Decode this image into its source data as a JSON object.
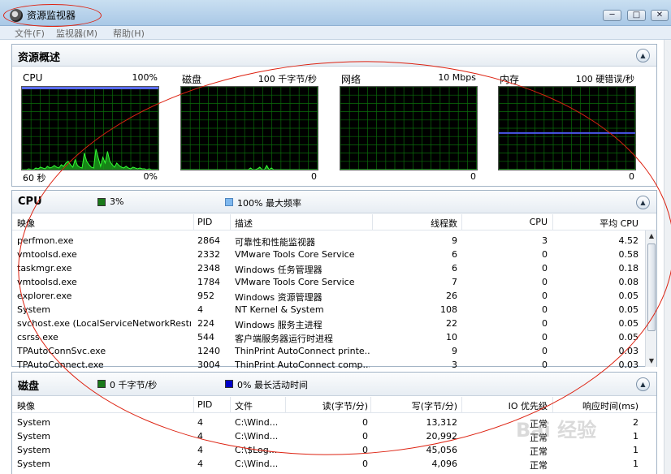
{
  "window": {
    "title": "资源监视器",
    "btn_min": "─",
    "btn_max": "□",
    "btn_close": "✕"
  },
  "menu": [
    "文件(F)",
    "监视器(M)",
    "帮助(H)"
  ],
  "overview": {
    "title": "资源概述",
    "collapse_glyph": "▲",
    "graphs": [
      {
        "label": "CPU",
        "max": "100%",
        "bottom_left": "60 秒",
        "bottom_right": "0%"
      },
      {
        "label": "磁盘",
        "max": "100 千字节/秒",
        "bottom_left": "",
        "bottom_right": "0"
      },
      {
        "label": "网络",
        "max": "10 Mbps",
        "bottom_left": "",
        "bottom_right": "0"
      },
      {
        "label": "内存",
        "max": "100 硬错误/秒",
        "bottom_left": "",
        "bottom_right": "0"
      }
    ]
  },
  "cpu": {
    "title": "CPU",
    "collapse_glyph": "▲",
    "legend1": "3%",
    "legend2": "100% 最大频率",
    "legend1_color": "#1a7a1a",
    "legend2_color": "#7fb8ee",
    "columns": [
      "映像",
      "PID",
      "描述",
      "线程数",
      "CPU",
      "平均 CPU"
    ],
    "rows": [
      [
        "perfmon.exe",
        "2864",
        "可靠性和性能监视器",
        "9",
        "3",
        "4.52"
      ],
      [
        "vmtoolsd.exe",
        "2332",
        "VMware Tools Core Service",
        "6",
        "0",
        "0.58"
      ],
      [
        "taskmgr.exe",
        "2348",
        "Windows 任务管理器",
        "6",
        "0",
        "0.18"
      ],
      [
        "vmtoolsd.exe",
        "1784",
        "VMware Tools Core Service",
        "7",
        "0",
        "0.08"
      ],
      [
        "explorer.exe",
        "952",
        "Windows 资源管理器",
        "26",
        "0",
        "0.05"
      ],
      [
        "System",
        "4",
        "NT Kernel & System",
        "108",
        "0",
        "0.05"
      ],
      [
        "svchost.exe (LocalServiceNetworkRestric...",
        "224",
        "Windows 服务主进程",
        "22",
        "0",
        "0.05"
      ],
      [
        "csrss.exe",
        "544",
        "客户端服务器运行时进程",
        "10",
        "0",
        "0.05"
      ],
      [
        "TPAutoConnSvc.exe",
        "1240",
        "ThinPrint AutoConnect printe...",
        "9",
        "0",
        "0.03"
      ],
      [
        "TPAutoConnect.exe",
        "3004",
        "ThinPrint AutoConnect comp...",
        "3",
        "0",
        "0.03"
      ]
    ]
  },
  "disk": {
    "title": "磁盘",
    "collapse_glyph": "▲",
    "legend1": "0 千字节/秒",
    "legend2": "0% 最长活动时间",
    "legend1_color": "#1a7a1a",
    "legend2_color": "#0000c8",
    "columns": [
      "映像",
      "PID",
      "文件",
      "读(字节/分)",
      "写(字节/分)",
      "IO 优先级",
      "响应时间(ms)"
    ],
    "rows": [
      [
        "System",
        "4",
        "C:\\Wind...",
        "0",
        "13,312",
        "正常",
        "2"
      ],
      [
        "System",
        "4",
        "C:\\Wind...",
        "0",
        "20,992",
        "正常",
        "1"
      ],
      [
        "System",
        "4",
        "C:\\$Log...",
        "0",
        "45,056",
        "正常",
        "1"
      ],
      [
        "System",
        "4",
        "C:\\Wind...",
        "0",
        "4,096",
        "正常",
        "1"
      ]
    ]
  },
  "watermark": "Bai 经验",
  "chart_data": [
    {
      "type": "line",
      "title": "CPU",
      "ylim": [
        0,
        100
      ],
      "x_span": "60 秒",
      "series": [
        {
          "values": [
            0,
            0,
            0,
            1,
            0,
            0,
            2,
            1,
            3,
            2,
            1,
            4,
            2,
            3,
            5,
            3,
            2,
            6,
            4,
            8,
            10,
            6,
            3,
            12,
            5,
            3,
            2,
            20,
            10,
            6,
            3,
            2,
            25,
            14,
            4,
            15,
            8,
            22,
            10,
            6,
            3,
            8,
            5,
            3,
            2,
            4,
            2,
            1,
            3,
            2,
            1,
            2,
            1,
            1,
            0,
            1,
            0,
            0,
            0,
            0
          ]
        }
      ]
    },
    {
      "type": "line",
      "title": "磁盘",
      "ylim": [
        0,
        100
      ],
      "series": [
        {
          "values": [
            0,
            0,
            0,
            0,
            0,
            0,
            0,
            0,
            0,
            0,
            0,
            0,
            0,
            0,
            0,
            0,
            0,
            0,
            0,
            0,
            0,
            0,
            0,
            0,
            0,
            0,
            0,
            0,
            0,
            0,
            2,
            0,
            0,
            1,
            3,
            0,
            0,
            5,
            0,
            2,
            0,
            0,
            0,
            0,
            0,
            0,
            0,
            0,
            0,
            0,
            0,
            0,
            0,
            0,
            0,
            0,
            0,
            0,
            0,
            0
          ]
        }
      ]
    },
    {
      "type": "line",
      "title": "网络",
      "ylim": [
        0,
        10
      ],
      "series": [
        {
          "values": [
            0,
            0,
            0,
            0,
            0,
            0,
            0,
            0,
            0,
            0,
            0,
            0,
            0,
            0,
            0,
            0,
            0,
            0,
            0,
            0,
            0,
            0,
            0,
            0,
            0,
            0,
            0,
            0,
            0,
            0,
            0,
            0,
            0,
            0,
            0,
            0,
            0,
            0,
            0,
            0,
            0,
            0,
            0,
            0,
            0,
            0,
            0,
            0,
            0,
            0,
            0,
            0,
            0,
            0,
            0,
            0,
            0,
            0,
            0,
            0
          ]
        }
      ]
    },
    {
      "type": "line",
      "title": "内存",
      "ylim": [
        0,
        100
      ],
      "series": [
        {
          "values": [
            0,
            0,
            0,
            0,
            0,
            0,
            0,
            0,
            0,
            0,
            0,
            0,
            0,
            0,
            0,
            0,
            0,
            0,
            0,
            0,
            0,
            0,
            0,
            0,
            0,
            0,
            0,
            0,
            0,
            0,
            0,
            0,
            0,
            0,
            0,
            0,
            0,
            0,
            0,
            0,
            0,
            0,
            0,
            0,
            0,
            0,
            0,
            0,
            0,
            0,
            0,
            0,
            0,
            0,
            0,
            0,
            0,
            0,
            0,
            0
          ]
        }
      ]
    }
  ]
}
